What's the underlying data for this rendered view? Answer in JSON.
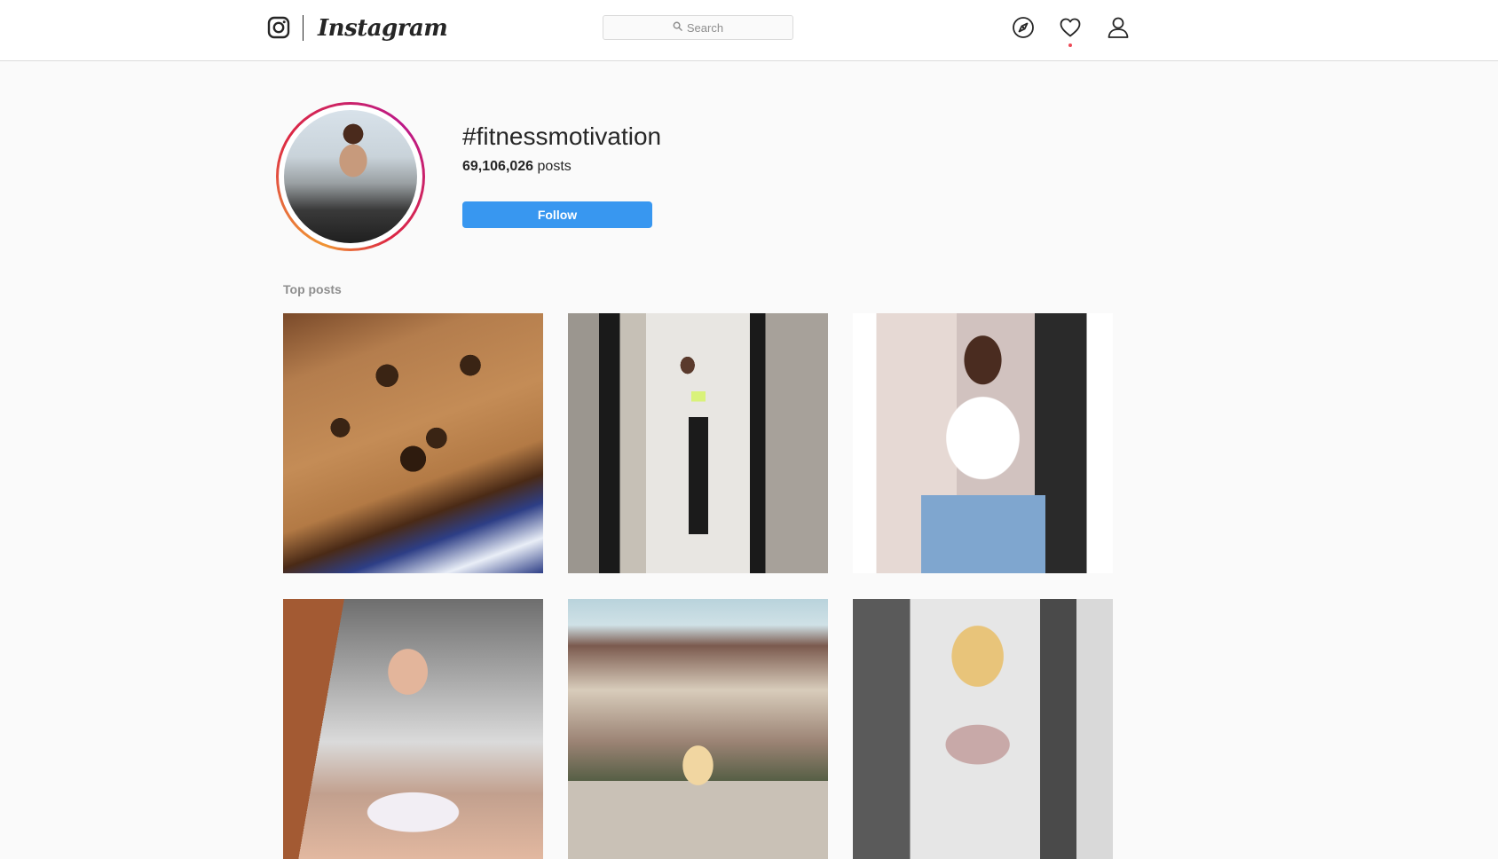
{
  "app": {
    "name": "Instagram"
  },
  "nav": {
    "search_placeholder": "Search",
    "icons": [
      "instagram-glyph-icon",
      "search-icon",
      "explore-compass-icon",
      "activity-heart-icon",
      "profile-person-icon"
    ],
    "has_notification": true
  },
  "header": {
    "hashtag": "#fitnessmotivation",
    "posts_count": "69,106,026",
    "posts_label": "posts",
    "follow_label": "Follow"
  },
  "top_posts": {
    "label": "Top posts",
    "items": [
      {
        "subject": "chocolate chip cookie cake on blue and white plate"
      },
      {
        "subject": "mirror selfie in sports bra and black leggings"
      },
      {
        "subject": "woman in white tank top and jeans"
      },
      {
        "subject": "woman with long hair in white bralette in kitchen"
      },
      {
        "subject": "blonde woman in front of timbered building"
      },
      {
        "subject": "curly-haired blonde woman in pink crop top"
      }
    ]
  },
  "colors": {
    "background": "#fafafa",
    "nav_background": "#ffffff",
    "border": "#dbdbdb",
    "follow_button": "#3897f0",
    "text_primary": "#262626",
    "text_secondary": "#8e8e8e",
    "notification_dot": "#ed4956"
  }
}
